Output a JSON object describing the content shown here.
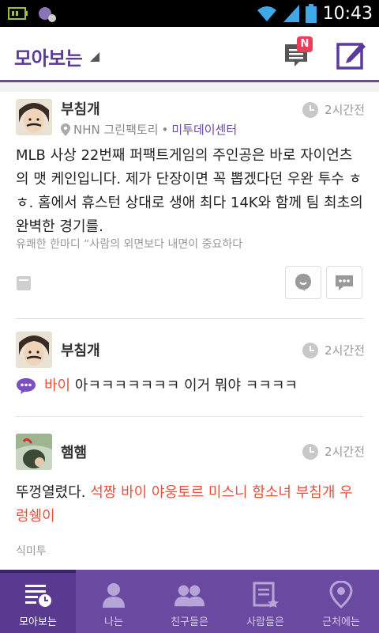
{
  "statusbar": {
    "time": "10:43"
  },
  "header": {
    "title": "모아보는",
    "notification_badge": "N"
  },
  "posts": [
    {
      "author": "부침개",
      "time": "2시간전",
      "location": "NHN 그린팩토리",
      "location_tag": "미투데이센터",
      "body": "MLB 사상 22번째 퍼팩트게임의 주인공은 바로 자이언츠의 맷 케인입니다. 제가 단장이면 꼭 뽑겠다던 우완 투수 ㅎㅎ. 홈에서 휴스턴 상대로 생애 최다 14K와 함께 팀 최초의 완벽한 경기를.",
      "subtext": "유쾌한 한마디 “사람의 외면보다 내면이 중요하다"
    },
    {
      "author": "부침개",
      "time": "2시간전",
      "highlight": "바이",
      "body": " 아ㅋㅋㅋㅋㅋㅋㅋ 이거 뭐야 ㅋㅋㅋㅋ"
    },
    {
      "author": "햄햄",
      "time": "2시간전",
      "body_start": "뚜껑열렸다. ",
      "highlight": "석짱 바이 야웅토르 미스니 함소녀 부침개 우렁쉥이",
      "subtext": "식미투"
    }
  ],
  "nav": [
    {
      "label": "모아보는",
      "icon": "feed-icon"
    },
    {
      "label": "나는",
      "icon": "person-icon"
    },
    {
      "label": "친구들은",
      "icon": "friends-icon"
    },
    {
      "label": "사람들은",
      "icon": "people-icon"
    },
    {
      "label": "근처에는",
      "icon": "location-icon"
    }
  ],
  "colors": {
    "accent": "#6a4aa0",
    "highlight": "#e84f3c",
    "badge": "#ef3c5b"
  }
}
